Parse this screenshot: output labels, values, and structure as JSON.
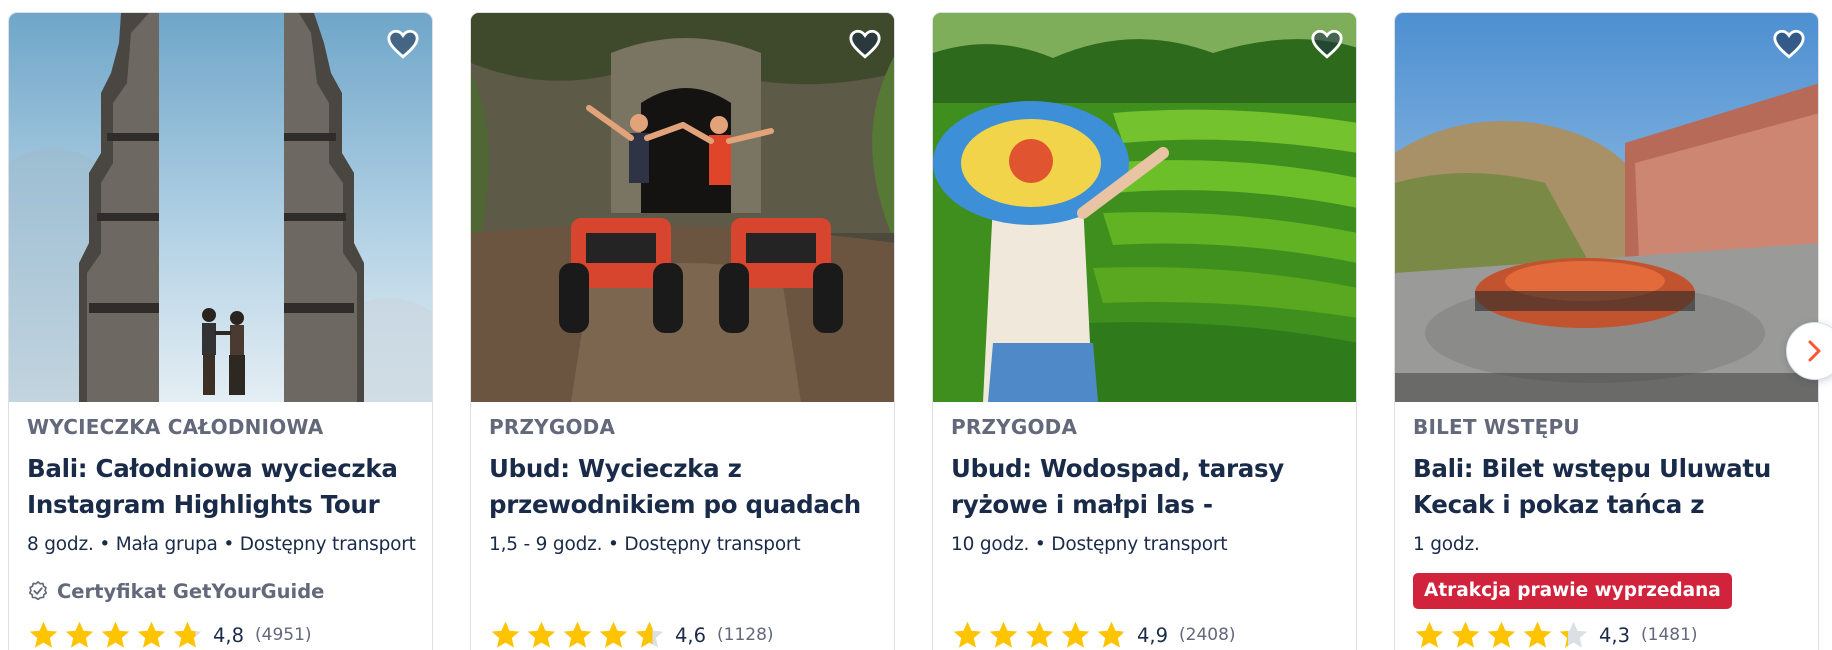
{
  "colors": {
    "text_primary": "#1a2b49",
    "text_secondary": "#63687a",
    "star": "#ffc400",
    "star_empty": "#dcdfe4",
    "badge_red": "#d2233c",
    "next_arrow": "#ff5533"
  },
  "cards": [
    {
      "category": "WYCIECZKA CAŁODNIOWA",
      "title": "Bali: Całodniowa wycieczka Instagram Highlights Tour",
      "meta": "8 godz. • Mała grupa • Dostępny transport",
      "certificate": "Certyfikat GetYourGuide",
      "rating_value": 4.8,
      "rating_text": "4,8",
      "review_count": "(4951)",
      "image": "temple-gate-photo",
      "wishlist_icon": "heart-icon"
    },
    {
      "category": "PRZYGODA",
      "title": "Ubud: Wycieczka z przewodnikiem po quadach ATV",
      "meta": "1,5 - 9 godz. • Dostępny transport",
      "rating_value": 4.6,
      "rating_text": "4,6",
      "review_count": "(1128)",
      "image": "atv-quad-photo",
      "wishlist_icon": "heart-icon"
    },
    {
      "category": "PRZYGODA",
      "title": "Ubud: Wodospad, tarasy ryżowe i małpi las - wycieczka prywatna",
      "meta": "10 godz. • Dostępny transport",
      "rating_value": 4.9,
      "rating_text": "4,9",
      "review_count": "(2408)",
      "image": "rice-terrace-photo",
      "wishlist_icon": "heart-icon"
    },
    {
      "category": "BILET WSTĘPU",
      "title": "Bali: Bilet wstępu Uluwatu Kecak i pokaz tańca z ogniem",
      "meta": "1 godz.",
      "badge": "Atrakcja prawie wyprzedana",
      "rating_value": 4.3,
      "rating_text": "4,3",
      "review_count": "(1481)",
      "image": "kecak-dance-photo",
      "wishlist_icon": "heart-icon"
    }
  ],
  "next_button_icon": "chevron-right-icon"
}
